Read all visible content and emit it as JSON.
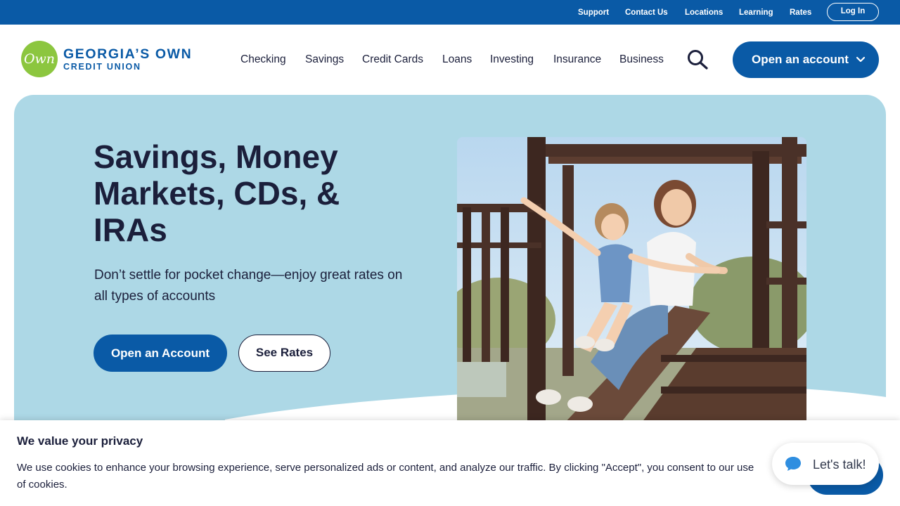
{
  "utility_nav": {
    "links": [
      "Support",
      "Contact Us",
      "Locations",
      "Learning",
      "Rates"
    ],
    "login": "Log In"
  },
  "header": {
    "logo": {
      "mark": "Own",
      "line1": "GEORGIA’S OWN",
      "line2": "CREDIT UNION"
    },
    "nav": [
      "Checking",
      "Savings",
      "Credit Cards",
      "Loans",
      "Investing",
      "Insurance",
      "Business"
    ],
    "search_icon": "search-icon",
    "open_account": "Open an account"
  },
  "hero": {
    "title": "Savings, Money Markets, CDs, & IRAs",
    "subtitle": "Don’t settle for pocket change—enjoy great rates on all types of accounts",
    "primary_button": "Open an Account",
    "secondary_button": "See Rates"
  },
  "cookie_banner": {
    "title": "We value your privacy",
    "text": "We use cookies to enhance your browsing experience, serve personalized ads or content, and analyze our traffic. By clicking \"Accept\", you consent to our use of cookies."
  },
  "chat": {
    "label": "Let's talk!",
    "icon": "chat-icon"
  },
  "colors": {
    "brand_blue": "#0a5aa6",
    "hero_bg": "#add8e6",
    "logo_green": "#8cc63f",
    "text_dark": "#1b1f3b"
  }
}
